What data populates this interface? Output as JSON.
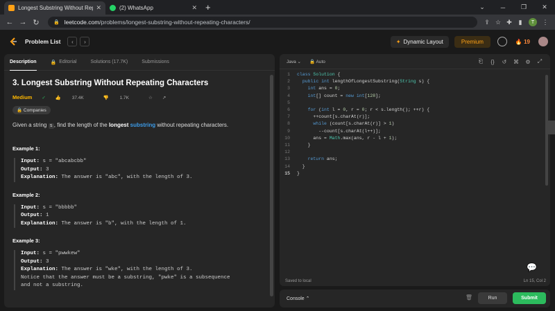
{
  "browser": {
    "tabs": [
      {
        "title": "Longest Substring Without Repe",
        "favicon_color": "#ffa116"
      },
      {
        "title": "(2) WhatsApp",
        "favicon_color": "#25d366"
      }
    ],
    "url_host": "leetcode.com",
    "url_path": "/problems/longest-substring-without-repeating-characters/",
    "profile_letter": "T"
  },
  "lc_nav": {
    "problem_list": "Problem List",
    "dynamic_layout": "Dynamic Layout",
    "premium": "Premium",
    "streak": "19"
  },
  "left": {
    "tabs": [
      {
        "label": "Description"
      },
      {
        "label": "Editorial"
      },
      {
        "label": "Solutions (17.7K)"
      },
      {
        "label": "Submissions"
      }
    ],
    "title": "3. Longest Substring Without Repeating Characters",
    "difficulty": "Medium",
    "likes": "37.4K",
    "dislikes": "1.7K",
    "companies": "Companies",
    "desc_pre": "Given a string ",
    "desc_code": "s",
    "desc_mid": ", find the length of the ",
    "desc_bold": "longest",
    "desc_link": "substring",
    "desc_post": " without repeating characters.",
    "examples": [
      {
        "head": "Example 1:",
        "input": "s = \"abcabcbb\"",
        "output": "3",
        "explanation": "The answer is \"abc\", with the length of 3.",
        "extra": ""
      },
      {
        "head": "Example 2:",
        "input": "s = \"bbbbb\"",
        "output": "1",
        "explanation": "The answer is \"b\", with the length of 1.",
        "extra": ""
      },
      {
        "head": "Example 3:",
        "input": "s = \"pwwkew\"",
        "output": "3",
        "explanation": "The answer is \"wke\", with the length of 3.",
        "extra": "Notice that the answer must be a substring, \"pwke\" is a subsequence\nand not a substring."
      }
    ],
    "labels": {
      "input": "Input:",
      "output": "Output:",
      "explanation": "Explanation:"
    }
  },
  "editor": {
    "language": "Java",
    "mode": "Auto",
    "lines": [
      "class Solution {",
      "  public int lengthOfLongestSubstring(String s) {",
      "    int ans = 0;",
      "    int[] count = new int[128];",
      "",
      "    for (int l = 0, r = 0; r < s.length(); ++r) {",
      "      ++count[s.charAt(r)];",
      "      while (count[s.charAt(r)] > 1)",
      "        --count[s.charAt(l++)];",
      "      ans = Math.max(ans, r - l + 1);",
      "    }",
      "",
      "    return ans;",
      "  }",
      "}"
    ],
    "current_line": 15,
    "saved": "Saved to local",
    "cursor": "Ln 15, Col 2"
  },
  "bottom": {
    "console": "Console",
    "run": "Run",
    "submit": "Submit"
  }
}
